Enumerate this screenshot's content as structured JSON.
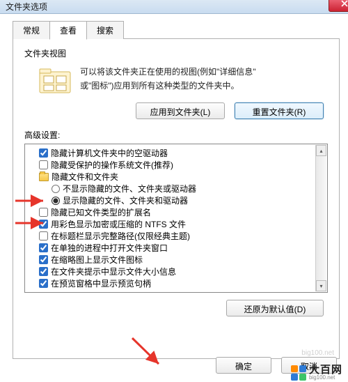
{
  "window": {
    "title": "文件夹选项"
  },
  "tabs": [
    {
      "label": "常规"
    },
    {
      "label": "查看"
    },
    {
      "label": "搜索"
    }
  ],
  "folder_view": {
    "title": "文件夹视图",
    "desc_line1": "可以将该文件夹正在使用的视图(例如\"详细信息\"",
    "desc_line2": "或\"图标\")应用到所有这种类型的文件夹中。",
    "apply_btn": "应用到文件夹(L)",
    "reset_btn": "重置文件夹(R)"
  },
  "advanced": {
    "title": "高级设置:",
    "items": [
      {
        "type": "checkbox",
        "checked": true,
        "indent": 1,
        "label": "隐藏计算机文件夹中的空驱动器"
      },
      {
        "type": "checkbox",
        "checked": false,
        "indent": 1,
        "label": "隐藏受保护的操作系统文件(推荐)"
      },
      {
        "type": "folder",
        "indent": 1,
        "label": "隐藏文件和文件夹"
      },
      {
        "type": "radio",
        "checked": false,
        "indent": 2,
        "label": "不显示隐藏的文件、文件夹或驱动器"
      },
      {
        "type": "radio",
        "checked": true,
        "indent": 2,
        "label": "显示隐藏的文件、文件夹和驱动器"
      },
      {
        "type": "checkbox",
        "checked": false,
        "indent": 1,
        "label": "隐藏已知文件类型的扩展名"
      },
      {
        "type": "checkbox",
        "checked": true,
        "indent": 1,
        "label": "用彩色显示加密或压缩的 NTFS 文件"
      },
      {
        "type": "checkbox",
        "checked": false,
        "indent": 1,
        "label": "在标题栏显示完整路径(仅限经典主题)"
      },
      {
        "type": "checkbox",
        "checked": true,
        "indent": 1,
        "label": "在单独的进程中打开文件夹窗口"
      },
      {
        "type": "checkbox",
        "checked": true,
        "indent": 1,
        "label": "在缩略图上显示文件图标"
      },
      {
        "type": "checkbox",
        "checked": true,
        "indent": 1,
        "label": "在文件夹提示中显示文件大小信息"
      },
      {
        "type": "checkbox",
        "checked": true,
        "indent": 1,
        "label": "在预览窗格中显示预览句柄"
      }
    ]
  },
  "restore_btn": "还原为默认值(D)",
  "ok_btn": "确定",
  "cancel_btn": "取消",
  "watermark": "big100.net",
  "logo": {
    "cn": "大百网",
    "en": "big100.net"
  },
  "colors": {
    "accent": "#3c7fb1",
    "arrow": "#e6352b"
  }
}
